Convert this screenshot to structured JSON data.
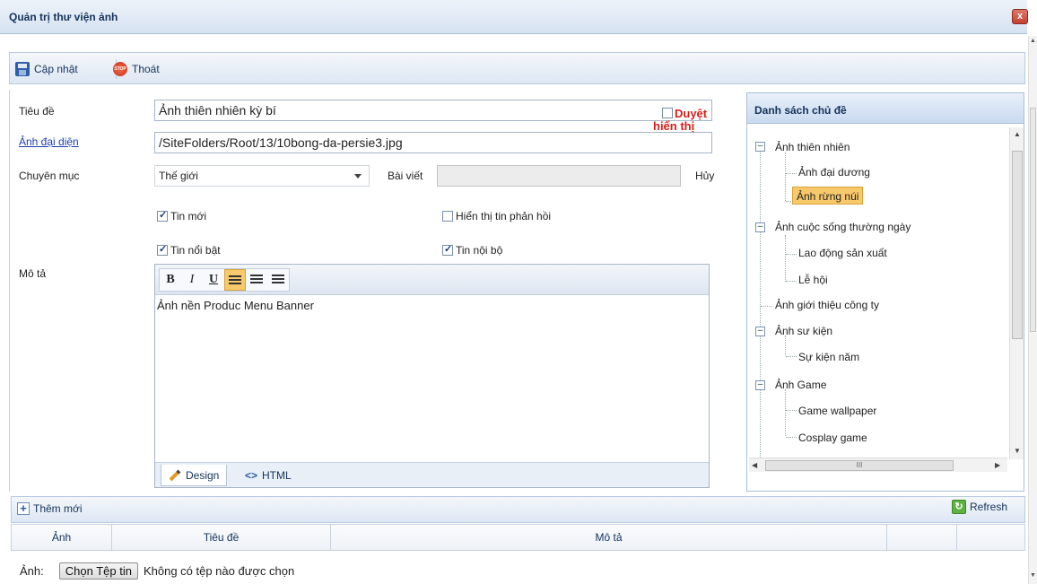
{
  "window": {
    "title": "Quản trị thư viện ảnh",
    "close_label": "x"
  },
  "toolbar": {
    "update_label": "Cập nhật",
    "exit_label": "Thoát",
    "stop_text": "STOP"
  },
  "form": {
    "title_label": "Tiêu đề",
    "title_value": "Ảnh thiên nhiên kỳ bí",
    "avatar_label": "Ảnh đại diện",
    "avatar_value": "/SiteFolders/Root/13/10bong-da-persie3.jpg",
    "category_label": "Chuyên mục",
    "category_value": "Thế giới",
    "article_label": "Bài viết",
    "article_value": "",
    "cancel_label": "Hủy",
    "checkboxes": {
      "new_news": {
        "label": "Tin mới",
        "checked": true
      },
      "show_feedback": {
        "label": "Hiển thị tin phản hồi",
        "checked": false
      },
      "featured": {
        "label": "Tin nổi bật",
        "checked": true
      },
      "internal": {
        "label": "Tin nội bộ",
        "checked": true
      }
    },
    "approve_label": "Duyệt hiển thị",
    "description_label": "Mô tả"
  },
  "editor": {
    "bold": "B",
    "italic": "I",
    "underline": "U",
    "content": "Ảnh nền Produc Menu Banner",
    "tab_design": "Design",
    "tab_html": "HTML",
    "html_icon": "<>"
  },
  "topics": {
    "header": "Danh sách chủ đề",
    "items": [
      {
        "label": "Ảnh thiên nhiên",
        "level": 0
      },
      {
        "label": "Ảnh đại dương",
        "level": 1
      },
      {
        "label": "Ảnh rừng núi",
        "level": 1,
        "selected": true
      },
      {
        "label": "Ảnh cuộc sống thường ngày",
        "level": 0
      },
      {
        "label": "Lao động sản xuất",
        "level": 1
      },
      {
        "label": "Lễ hội",
        "level": 1
      },
      {
        "label": "Ảnh giới thiệu công ty",
        "level": 0
      },
      {
        "label": "Ảnh sư kiện",
        "level": 0
      },
      {
        "label": "Sự kiện năm",
        "level": 1
      },
      {
        "label": "Ảnh Game",
        "level": 0
      },
      {
        "label": "Game wallpaper",
        "level": 1
      },
      {
        "label": "Cosplay game",
        "level": 1
      }
    ],
    "hscroll_mark": "III"
  },
  "list": {
    "add_label": "Thêm mới",
    "refresh_label": "Refresh",
    "columns": [
      "Ảnh",
      "Tiêu đề",
      "Mô tả",
      "",
      ""
    ]
  },
  "upload": {
    "label": "Ảnh:",
    "button": "Chọn Tệp tin",
    "status": "Không có tệp nào được chọn"
  }
}
